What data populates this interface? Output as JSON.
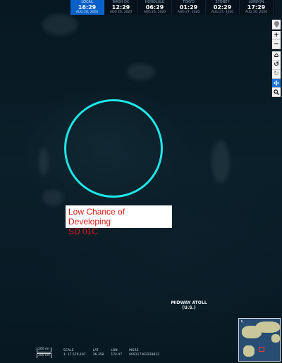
{
  "time_zones": [
    {
      "zone": "LOCAL",
      "time": "16:29",
      "date": "AUG 26, 2020",
      "active": true
    },
    {
      "zone": "WASH DC",
      "time": "12:29",
      "date": "AUG 26, 2020",
      "active": false
    },
    {
      "zone": "HONOLULU",
      "time": "06:29",
      "date": "AUG 26, 2020",
      "active": false
    },
    {
      "zone": "TOKYO",
      "time": "01:29",
      "date": "AUG 27, 2020",
      "active": false
    },
    {
      "zone": "SYDNEY",
      "time": "02:29",
      "date": "AUG 27, 2020",
      "active": false
    },
    {
      "zone": "LONDON",
      "time": "17:29",
      "date": "AUG 26, 2020",
      "active": false
    }
  ],
  "toolbar": {
    "icons": [
      "locate-icon",
      "zoom-in-icon",
      "zoom-out-icon",
      "home-icon",
      "undo-icon",
      "redo-icon",
      "pan-icon",
      "search-icon"
    ],
    "active_tool": "pan-icon"
  },
  "storm_label": {
    "line1": "Low Chance of Developing",
    "line2": "SD 01C",
    "text_color": "#e01818",
    "circle_color": "#1fe6e6"
  },
  "place_label": {
    "line1": "MIDWAY ATOLL",
    "line2": "(U.S.)"
  },
  "scale": {
    "miles": "200 mi",
    "km": "200 km"
  },
  "readout": {
    "scale_label": "SCALE",
    "lat_label": "LAT",
    "lon_label": "LON",
    "mgrs_label": "MGRS",
    "scale_value": "1: 17,579,197",
    "lat_value": "36.358",
    "lon_value": "174.47",
    "mgrs_value": "60S117302228812"
  },
  "minimap": {
    "water_color": "#274d73",
    "land_color": "#c9c79a"
  }
}
